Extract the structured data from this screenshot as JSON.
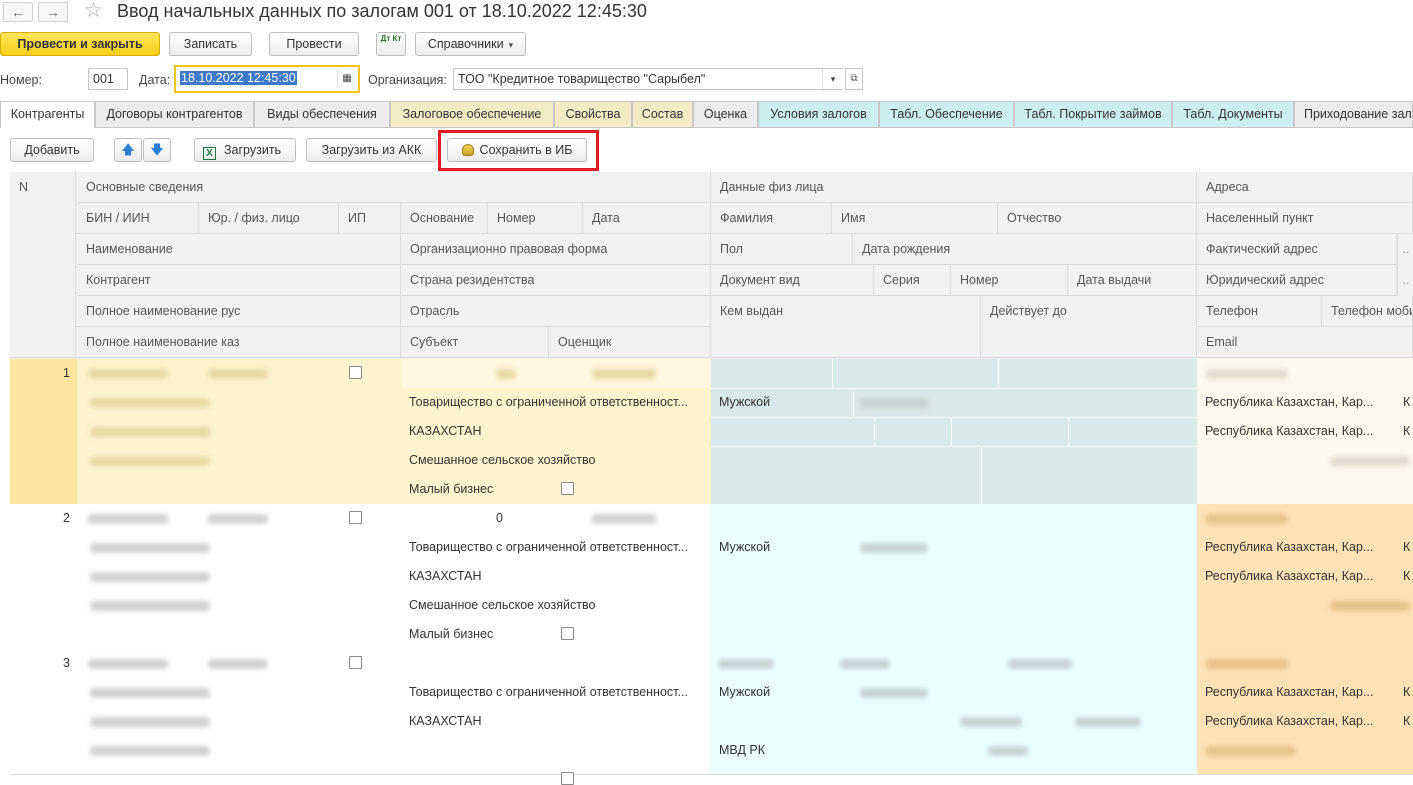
{
  "window": {
    "title": "Ввод начальных данных по залогам 001 от 18.10.2022 12:45:30"
  },
  "toolbar": {
    "post_close": "Провести и закрыть",
    "save": "Записать",
    "post": "Провести",
    "dtkt": "Дт Кт",
    "directories": "Справочники"
  },
  "header": {
    "number_label": "Номер:",
    "number_value": "001",
    "date_label": "Дата:",
    "date_value": "18.10.2022 12:45:30",
    "org_label": "Организация:",
    "org_value": "ТОО \"Кредитное товарищество \"Сарыбел\""
  },
  "tabs": [
    "Контрагенты",
    "Договоры контрагентов",
    "Виды обеспечения",
    "Залоговое обеспечение",
    "Свойства",
    "Состав",
    "Оценка",
    "Условия залогов",
    "Табл. Обеспечение",
    "Табл. Покрытие займов",
    "Табл. Документы",
    "Приходование залогов"
  ],
  "subtoolbar": {
    "add": "Добавить",
    "load": "Загрузить",
    "load_akk": "Загрузить из АКК",
    "save_ib": "Сохранить в ИБ"
  },
  "columns": {
    "n": "N",
    "main": "Основные сведения",
    "bin": "БИН / ИИН",
    "entity": "Юр. / физ. лицо",
    "ip": "ИП",
    "basis": "Основание",
    "number": "Номер",
    "date": "Дата",
    "name": "Наименование",
    "opf": "Организационно правовая форма",
    "counterparty": "Контрагент",
    "country": "Страна резидентства",
    "full_ru": "Полное наименование рус",
    "industry": "Отрасль",
    "full_kz": "Полное наименование каз",
    "subject": "Субъект",
    "appraiser": "Оценщик",
    "person": "Данные физ лица",
    "surname": "Фамилия",
    "given": "Имя",
    "patronymic": "Отчество",
    "sex": "Пол",
    "birth": "Дата рождения",
    "doc_type": "Документ вид",
    "series": "Серия",
    "doc_number": "Номер",
    "issue_date": "Дата выдачи",
    "issued_by": "Кем выдан",
    "valid_to": "Действует до",
    "addresses": "Адреса",
    "locality": "Населенный пункт",
    "actual_addr": "Фактический адрес",
    "legal_addr": "Юридический адрес",
    "phone": "Телефон",
    "mobile": "Телефон моби",
    "email": "Email"
  },
  "rows": [
    {
      "n": "1",
      "opf": "Товарищество с ограниченной ответственност...",
      "country": "КАЗАХСТАН",
      "industry": "Смешанное сельское хозяйство",
      "subject": "Малый бизнес",
      "sex": "Мужской",
      "actual_addr": "Республика Казахстан, Кар...",
      "legal_addr": "Республика Казахстан, Кар..."
    },
    {
      "n": "2",
      "number": "0",
      "opf": "Товарищество с ограниченной ответственност...",
      "country": "КАЗАХСТАН",
      "industry": "Смешанное сельское хозяйство",
      "subject": "Малый бизнес",
      "sex": "Мужской",
      "actual_addr": "Республика Казахстан, Кар...",
      "legal_addr": "Республика Казахстан, Кар..."
    },
    {
      "n": "3",
      "opf": "Товарищество с ограниченной ответственност...",
      "country": "КАЗАХСТАН",
      "sex": "Мужской",
      "issued_by": "МВД РК",
      "actual_addr": "Республика Казахстан, Кар...",
      "legal_addr": "Республика Казахстан, Кар..."
    }
  ],
  "colors": {
    "accent_yellow": "#f5cf16",
    "row_selected": "#fdf3cf",
    "person_block": "#d9e8e8",
    "person_block_alt": "#eaffff",
    "address_block": "#fde2b5",
    "highlight_box": "#e01b22"
  }
}
